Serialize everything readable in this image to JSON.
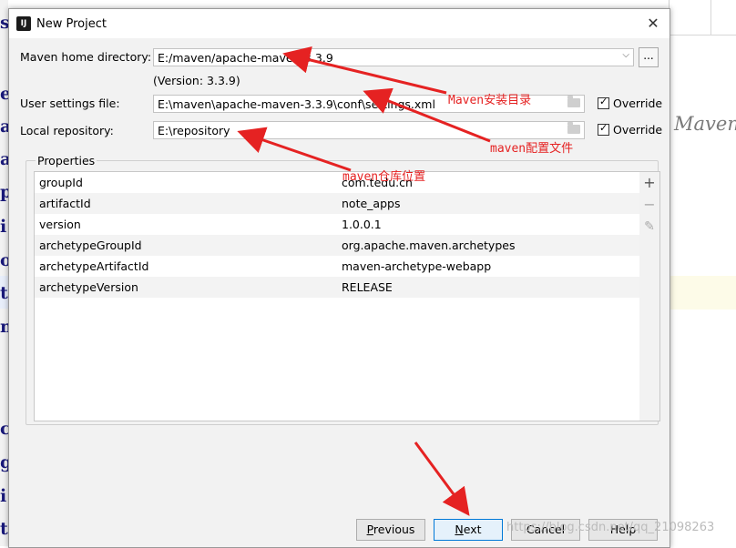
{
  "background": {
    "left_chars": [
      "s",
      "e",
      "a",
      "a",
      "p",
      "i",
      "o",
      "t",
      "m",
      "c",
      "g",
      "i",
      "t"
    ],
    "right_text": "Maven"
  },
  "dialog": {
    "title": "New Project",
    "app_icon": "IJ",
    "close_label": "✕"
  },
  "form": {
    "maven_home_label": "Maven home directory:",
    "maven_home_value": "E:/maven/apache-maven-3.3.9",
    "version_text": "(Version: 3.3.9)",
    "browse_label": "...",
    "settings_label": "User settings file:",
    "settings_value": "E:\\maven\\apache-maven-3.3.9\\conf\\settings.xml",
    "settings_override": "Override",
    "repo_label": "Local repository:",
    "repo_value": "E:\\repository",
    "repo_override": "Override"
  },
  "properties": {
    "title": "Properties",
    "rows": [
      {
        "key": "groupId",
        "value": "com.tedu.cn"
      },
      {
        "key": "artifactId",
        "value": "note_apps"
      },
      {
        "key": "version",
        "value": "1.0.0.1"
      },
      {
        "key": "archetypeGroupId",
        "value": "org.apache.maven.archetypes"
      },
      {
        "key": "archetypeArtifactId",
        "value": "maven-archetype-webapp"
      },
      {
        "key": "archetypeVersion",
        "value": "RELEASE"
      }
    ],
    "add_icon": "+",
    "remove_icon": "−",
    "edit_icon": "✎"
  },
  "buttons": {
    "previous_u": "P",
    "previous_rest": "revious",
    "next_u": "N",
    "next_rest": "ext",
    "cancel": "Cancel",
    "help": "Help"
  },
  "annotations": {
    "maven_install": "Maven安装目录",
    "maven_config": "maven配置文件",
    "maven_repo": "maven仓库位置"
  },
  "watermark": "https://blog.csdn.net/qq_21098263",
  "colors": {
    "annotation_red": "#e52222",
    "primary_button_border": "#0078d7"
  }
}
